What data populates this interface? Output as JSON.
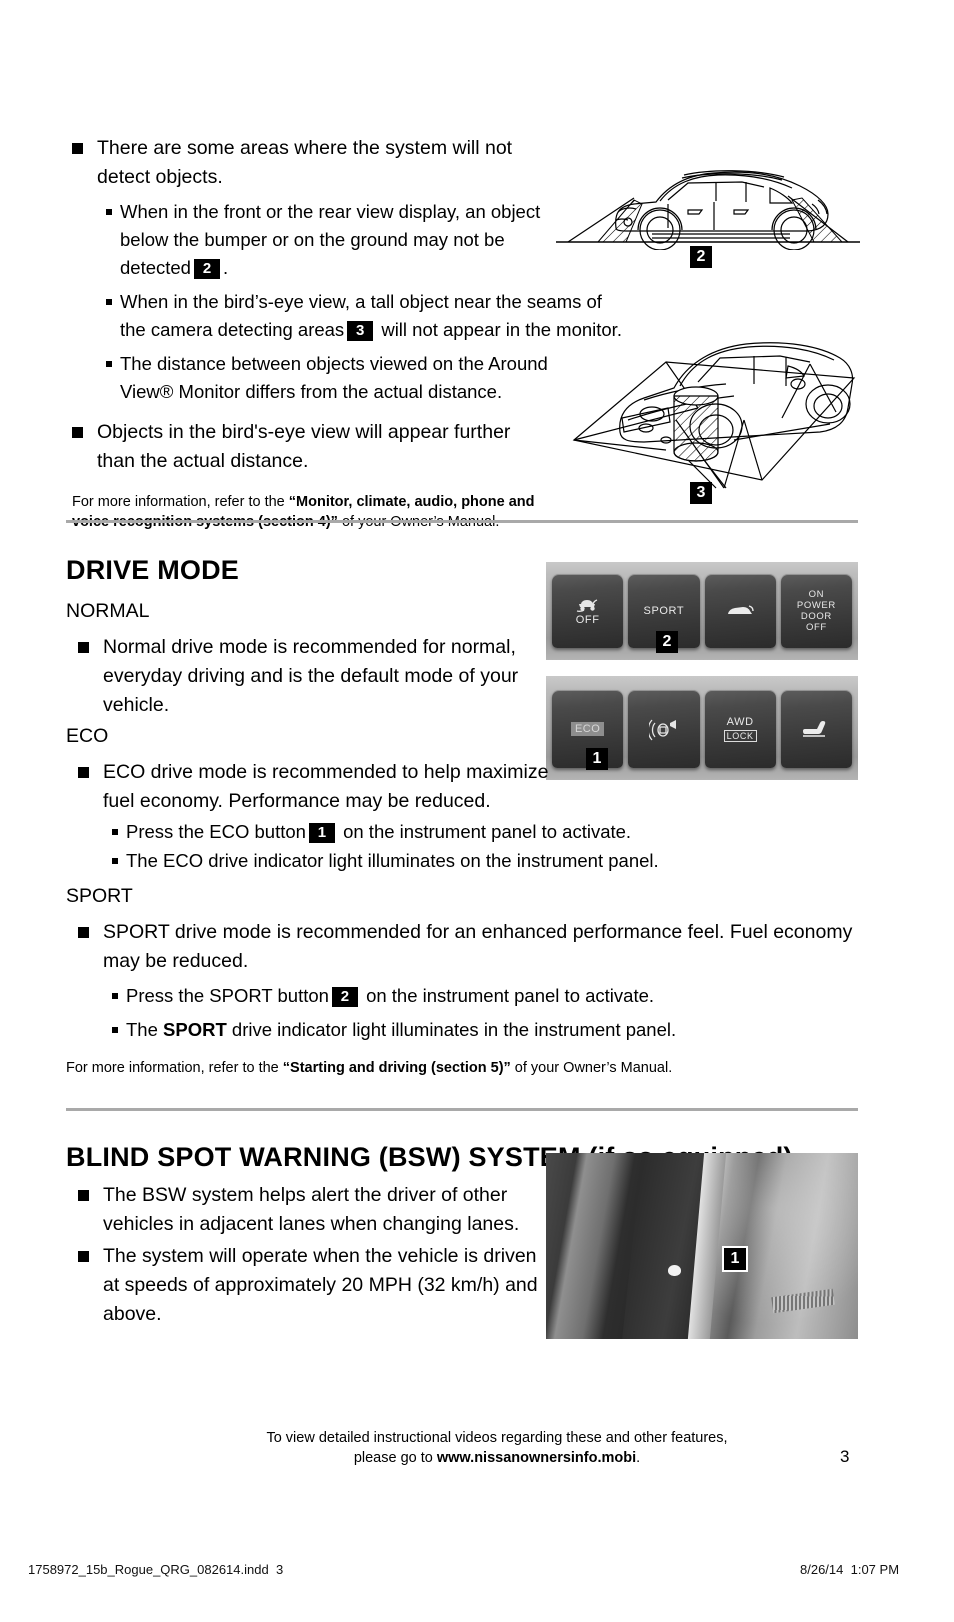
{
  "section_camera": {
    "bullets": [
      {
        "marker": "square",
        "text": "There are some areas where the system will not detect objects."
      }
    ],
    "sub_bullets": [
      {
        "before": "When in the front or the rear view display, an object below the bumper or on the ground may not be detected",
        "chip": "2",
        "after": "."
      },
      {
        "before": "When in the bird’s-eye view, a tall object near the seams of the camera detecting areas",
        "chip": "3",
        "after": "will not appear in the monitor."
      },
      {
        "before": "The distance between objects viewed on the Around View® Monitor differs from the actual distance.",
        "chip": "",
        "after": ""
      }
    ],
    "closing_bullet": "Objects in the bird's-eye view will appear further than the actual distance.",
    "note_prefix": "For more information, refer to the ",
    "note_bold": "“Monitor, climate, audio, phone and voice recognition systems (section 4)”",
    "note_suffix": " of your Owner’s Manual."
  },
  "figures": {
    "side_view": {
      "name": "vehicle-side-view-line-drawing",
      "callout": "2"
    },
    "birds_eye": {
      "name": "vehicle-birds-eye-view-line-drawing",
      "callout": "3"
    },
    "switch_panel_top": {
      "callout": "2",
      "buttons": [
        {
          "id": "vdc-off",
          "line1": "",
          "line2": "OFF",
          "icon": "vdc-off-icon"
        },
        {
          "id": "sport",
          "line1": "SPORT",
          "line2": "",
          "icon": ""
        },
        {
          "id": "liftgate",
          "line1": "",
          "line2": "",
          "icon": "power-liftgate-icon"
        },
        {
          "id": "power-door",
          "line1": "ON",
          "line2": "POWER DOOR",
          "line3": "OFF",
          "icon": ""
        }
      ]
    },
    "switch_panel_bottom": {
      "callout": "1",
      "buttons": [
        {
          "id": "eco",
          "line1": "ECO",
          "icon": ""
        },
        {
          "id": "parking-sensor",
          "line1": "",
          "icon": "parking-sensor-icon"
        },
        {
          "id": "awd-lock",
          "line1": "AWD",
          "line2": "LOCK",
          "icon": ""
        },
        {
          "id": "seat-heater",
          "line1": "",
          "icon": "seat-heater-icon"
        }
      ]
    },
    "bsw_photo": {
      "name": "bsw-indicator-photo",
      "callout": "1"
    }
  },
  "section_drive_mode": {
    "title": "DRIVE MODE",
    "normal": {
      "label": "NORMAL",
      "bullet": "Normal drive mode is recommended for normal, everyday driving and is the default mode of your vehicle."
    },
    "eco": {
      "label": "ECO",
      "bullet": "ECO drive mode is recommended to help maximize fuel economy. Performance may be reduced.",
      "sub1_before": "Press the ECO button",
      "sub1_chip": "1",
      "sub1_after": "on the instrument panel to activate.",
      "sub2": "The ECO drive indicator light illuminates on the instrument panel."
    },
    "sport": {
      "label": "SPORT",
      "bullet": "SPORT drive mode is recommended for an enhanced performance feel. Fuel economy may be reduced.",
      "sub1_before": "Press the SPORT button",
      "sub1_chip": "2",
      "sub1_after": "on the instrument panel to activate.",
      "sub2_before": "The ",
      "sub2_bold": "SPORT",
      "sub2_after": " drive indicator light illuminates in the instrument panel."
    },
    "note_prefix": "For more information, refer to the ",
    "note_bold": "“Starting and driving (section 5)”",
    "note_suffix": " of your Owner’s Manual."
  },
  "section_bsw": {
    "title_main": "BLIND SPOT WARNING (BSW) SYSTEM ",
    "title_sub": "(if so equipped)",
    "bullets": [
      "The BSW system helps alert the driver of other vehicles in adjacent lanes when changing lanes.",
      "The system will operate when the vehicle is driven at speeds of approximately 20 MPH (32 km/h) and above."
    ]
  },
  "footer": {
    "line1": "To view detailed instructional videos regarding these and other features,",
    "line2_prefix": "please go to ",
    "line2_url": "www.nissanownersinfo.mobi",
    "line2_suffix": ".",
    "page_number": "3"
  },
  "print_slug": {
    "filename": "1758972_15b_Rogue_QRG_082614.indd",
    "page": "3",
    "date": "8/26/14",
    "time": "1:07 PM"
  },
  "colors": {
    "divider": "#a9a9a9",
    "chip_bg": "#000000",
    "chip_fg": "#ffffff"
  }
}
